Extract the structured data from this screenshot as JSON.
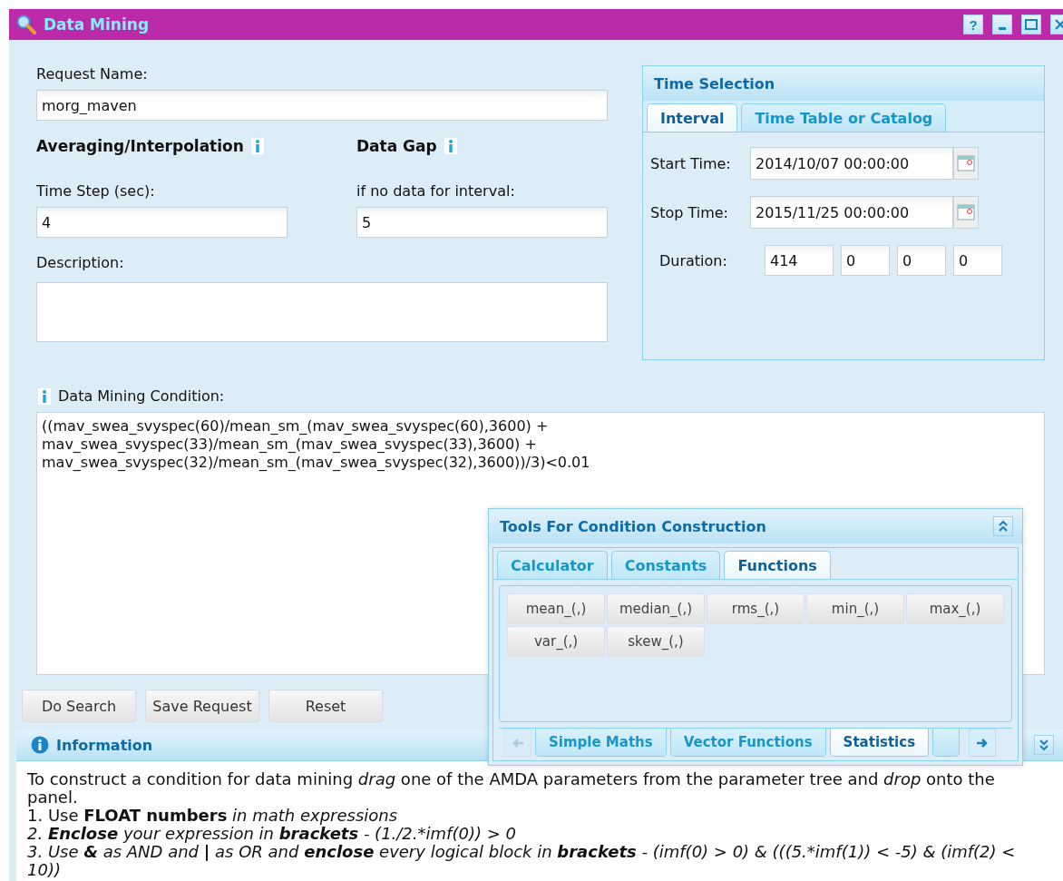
{
  "window": {
    "title": "Data Mining",
    "help": "?"
  },
  "request_name": {
    "label": "Request Name:",
    "value": "morg_maven"
  },
  "averaging": {
    "heading": "Averaging/Interpolation",
    "label": "Time Step (sec):",
    "value": "4"
  },
  "data_gap": {
    "heading": "Data Gap",
    "label": "if no data for interval:",
    "value": "5"
  },
  "description": {
    "label": "Description:"
  },
  "time_selection": {
    "title": "Time Selection",
    "tabs": [
      {
        "label": "Interval",
        "selected": true
      },
      {
        "label": "Time Table or Catalog",
        "selected": false
      }
    ],
    "start": {
      "label": "Start Time:",
      "value": "2014/10/07 00:00:00"
    },
    "stop": {
      "label": "Stop Time:",
      "value": "2015/11/25 00:00:00"
    },
    "duration": {
      "label": "Duration:",
      "values": [
        "414",
        "0",
        "0",
        "0"
      ]
    }
  },
  "condition": {
    "label": "Data Mining Condition:",
    "value": "((mav_swea_svyspec(60)/mean_sm_(mav_swea_svyspec(60),3600) +\nmav_swea_svyspec(33)/mean_sm_(mav_swea_svyspec(33),3600) +\nmav_swea_svyspec(32)/mean_sm_(mav_swea_svyspec(32),3600))/3)<0.01"
  },
  "buttons": [
    "Do Search",
    "Save Request",
    "Reset"
  ],
  "tools": {
    "title": "Tools For Condition Construction",
    "tabs": [
      {
        "label": "Calculator",
        "selected": false
      },
      {
        "label": "Constants",
        "selected": false
      },
      {
        "label": "Functions",
        "selected": true
      }
    ],
    "functions": [
      "mean_(,)",
      "median_(,)",
      "rms_(,)",
      "min_(,)",
      "max_(,)",
      "var_(,)",
      "skew_(,)"
    ],
    "groups": [
      {
        "label": "Simple Maths",
        "selected": false
      },
      {
        "label": "Vector Functions",
        "selected": false
      },
      {
        "label": "Statistics",
        "selected": true
      },
      {
        "selected": false
      }
    ]
  },
  "information": {
    "title": "Information",
    "lines": [
      {
        "text": "To construct a condition for data mining *drag* one of the AMDA parameters from the parameter tree and *drop* onto the panel.",
        "italic": false
      },
      {
        "text": "1. Use **FLOAT numbers** *in math expressions*",
        "italic": false
      },
      {
        "text": "2. **Enclose** your expression in **brackets** - (1./2.*imf(0)) > 0",
        "italic": true
      },
      {
        "text": "3. Use **&** as AND and **|** as OR and **enclose** every logical block in **brackets** - (imf(0) > 0) & (((5.*imf(1)) < -5) & (imf(2) < 10))",
        "italic": true
      }
    ]
  }
}
